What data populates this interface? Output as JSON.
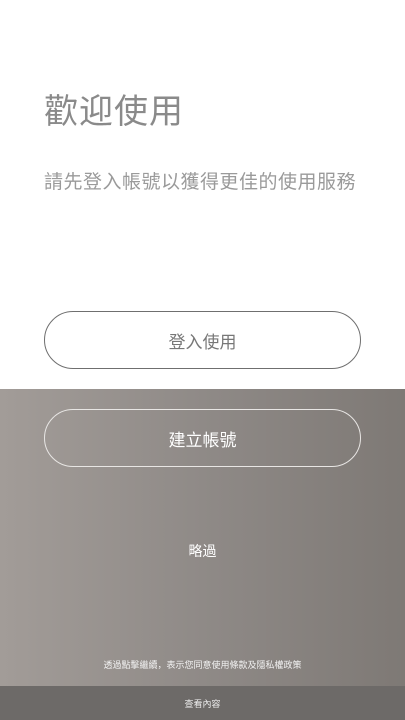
{
  "welcome": {
    "title": "歡迎使用",
    "subtitle": "請先登入帳號以獲得更佳的使用服務"
  },
  "actions": {
    "login_label": "登入使用",
    "create_account_label": "建立帳號",
    "skip_label": "略過"
  },
  "legal": {
    "terms_text": "透過點擊繼續，表示您同意使用條款及隱私權政策"
  },
  "footer": {
    "view_content_label": "查看內容"
  },
  "colors": {
    "background_top": "#ffffff",
    "gradient_left": "#a29c98",
    "gradient_right": "#7e7975",
    "footer_bar": "#6d6a68"
  }
}
